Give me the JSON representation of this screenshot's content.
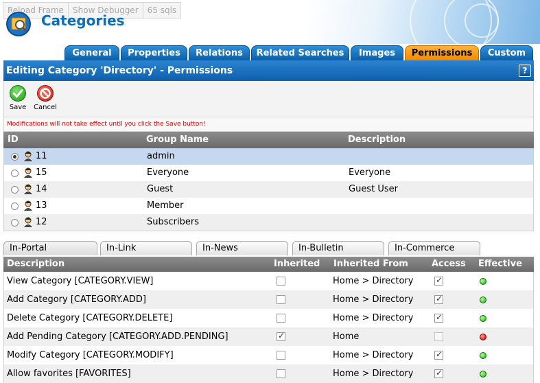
{
  "debug": {
    "reload": "Reload Frame",
    "debugger": "Show Debugger",
    "sqls": "65 sqls"
  },
  "app_title": "Categories",
  "tabs": [
    {
      "label": "General",
      "active": false
    },
    {
      "label": "Properties",
      "active": false
    },
    {
      "label": "Relations",
      "active": false
    },
    {
      "label": "Related Searches",
      "active": false
    },
    {
      "label": "Images",
      "active": false
    },
    {
      "label": "Permissions",
      "active": true
    },
    {
      "label": "Custom",
      "active": false
    }
  ],
  "section_title": "Editing Category 'Directory' - Permissions",
  "help_label": "?",
  "toolbar": {
    "save_label": "Save",
    "cancel_label": "Cancel"
  },
  "warning": "Modifications will not take effect until you click the Save button!",
  "groups": {
    "headers": {
      "id": "ID",
      "name": "Group Name",
      "description": "Description"
    },
    "rows": [
      {
        "id": "11",
        "name": "admin",
        "description": "",
        "selected": true
      },
      {
        "id": "15",
        "name": "Everyone",
        "description": "Everyone",
        "selected": false
      },
      {
        "id": "14",
        "name": "Guest",
        "description": "Guest User",
        "selected": false
      },
      {
        "id": "13",
        "name": "Member",
        "description": "",
        "selected": false
      },
      {
        "id": "12",
        "name": "Subscribers",
        "description": "",
        "selected": false
      }
    ]
  },
  "subtabs": [
    {
      "label": "In-Portal",
      "active": true
    },
    {
      "label": "In-Link",
      "active": false
    },
    {
      "label": "In-News",
      "active": false
    },
    {
      "label": "In-Bulletin",
      "active": false
    },
    {
      "label": "In-Commerce",
      "active": false
    }
  ],
  "permissions": {
    "headers": {
      "description": "Description",
      "inherited": "Inherited",
      "inherited_from": "Inherited From",
      "access": "Access",
      "effective": "Effective"
    },
    "rows": [
      {
        "description": "View Category [CATEGORY.VIEW]",
        "inherited": false,
        "inherited_from": "Home > Directory",
        "access": true,
        "access_enabled": true,
        "effective": true
      },
      {
        "description": "Add Category [CATEGORY.ADD]",
        "inherited": false,
        "inherited_from": "Home > Directory",
        "access": true,
        "access_enabled": true,
        "effective": true
      },
      {
        "description": "Delete Category [CATEGORY.DELETE]",
        "inherited": false,
        "inherited_from": "Home > Directory",
        "access": true,
        "access_enabled": true,
        "effective": true
      },
      {
        "description": "Add Pending Category [CATEGORY.ADD.PENDING]",
        "inherited": true,
        "inherited_from": "Home",
        "access": false,
        "access_enabled": false,
        "effective": false
      },
      {
        "description": "Modify Category [CATEGORY.MODIFY]",
        "inherited": false,
        "inherited_from": "Home > Directory",
        "access": true,
        "access_enabled": true,
        "effective": true
      },
      {
        "description": "Allow favorites [FAVORITES]",
        "inherited": false,
        "inherited_from": "Home > Directory",
        "access": true,
        "access_enabled": true,
        "effective": true
      }
    ]
  },
  "colors": {
    "tab_blue": "#0a5fa8",
    "tab_active": "#f08a00",
    "header_blue": "#0d5fac",
    "warning_red": "#d00000",
    "grid_header": "#7a7a7a",
    "selected_row": "#c6d8ef"
  }
}
